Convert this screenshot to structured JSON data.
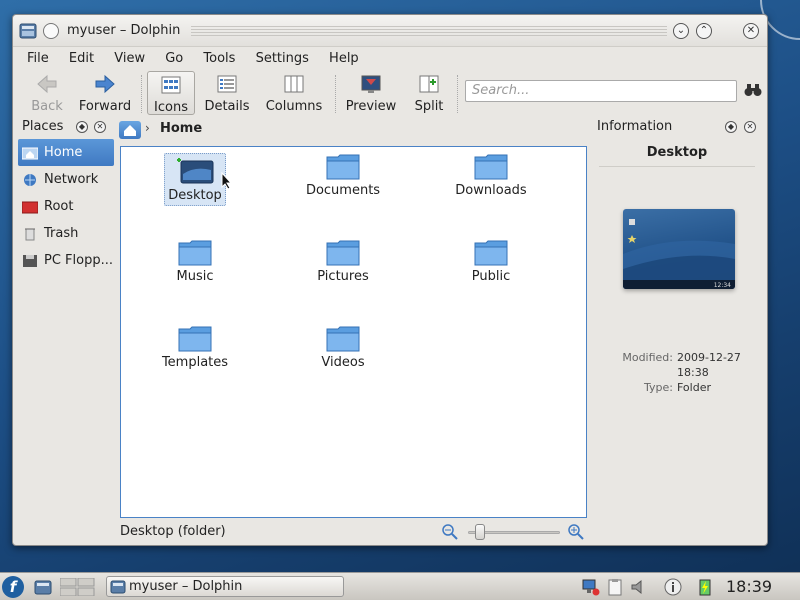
{
  "window": {
    "title": "myuser – Dolphin",
    "minimize_symbol": "⌄",
    "maximize_symbol": "⌃",
    "close_symbol": "✕"
  },
  "menu": [
    {
      "label": "File"
    },
    {
      "label": "Edit"
    },
    {
      "label": "View"
    },
    {
      "label": "Go"
    },
    {
      "label": "Tools"
    },
    {
      "label": "Settings"
    },
    {
      "label": "Help"
    }
  ],
  "toolbar": {
    "back": "Back",
    "forward": "Forward",
    "icons": "Icons",
    "details": "Details",
    "columns": "Columns",
    "preview": "Preview",
    "split": "Split",
    "search_placeholder": "Search..."
  },
  "places": {
    "title": "Places",
    "items": [
      {
        "label": "Home",
        "icon": "home-icon",
        "selected": true
      },
      {
        "label": "Network",
        "icon": "network-icon"
      },
      {
        "label": "Root",
        "icon": "root-folder-icon"
      },
      {
        "label": "Trash",
        "icon": "trash-icon"
      },
      {
        "label": "PC Flopp...",
        "icon": "floppy-icon"
      }
    ]
  },
  "breadcrumb": {
    "separator": "›",
    "current": "Home"
  },
  "files": [
    {
      "label": "Desktop",
      "selected": true
    },
    {
      "label": "Documents"
    },
    {
      "label": "Downloads"
    },
    {
      "label": "Music"
    },
    {
      "label": "Pictures"
    },
    {
      "label": "Public"
    },
    {
      "label": "Templates"
    },
    {
      "label": "Videos"
    }
  ],
  "status": {
    "text": "Desktop (folder)"
  },
  "info": {
    "title": "Information",
    "name": "Desktop",
    "preview_clock": "12:34",
    "modified_label": "Modified:",
    "modified_value": "2009-12-27",
    "modified_time": "18:38",
    "type_label": "Type:",
    "type_value": "Folder"
  },
  "taskbar": {
    "fedora": "f",
    "task": "myuser – Dolphin",
    "clock": "18:39"
  },
  "colors": {
    "selection": "#3f79c2",
    "folder": "#5b9ee0",
    "accent_border": "#4a82c6"
  }
}
